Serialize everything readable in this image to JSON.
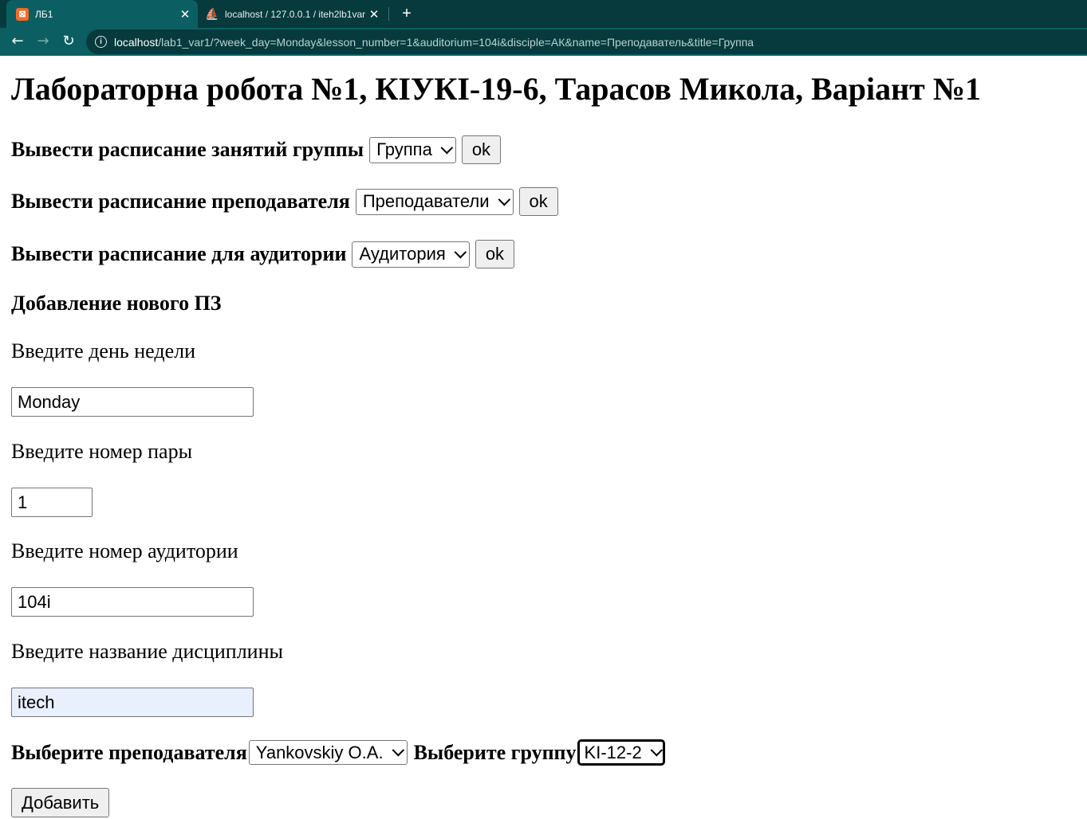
{
  "browser": {
    "tabs": [
      {
        "title": "ЛБ1",
        "favicon": "xampp-icon",
        "active": true
      },
      {
        "title": "localhost / 127.0.0.1 / iteh2lb1var",
        "favicon": "phpmyadmin-icon",
        "active": false
      }
    ],
    "url_host": "localhost",
    "url_rest": "/lab1_var1/?week_day=Monday&lesson_number=1&auditorium=104i&disciple=АК&name=Преподаватель&title=Группа",
    "colors": {
      "tabstrip": "#063a3c",
      "toolbar": "#0b5f62"
    }
  },
  "page": {
    "heading": "Лабораторна робота №1, КІУКІ-19-6, Тарасов Микола, Варіант №1",
    "group_schedule": {
      "label": "Вывести расписание занятий группы",
      "select_value": "Группа",
      "button": "ok"
    },
    "teacher_schedule": {
      "label": "Вывести расписание преподавателя",
      "select_value": "Преподаватели",
      "button": "ok"
    },
    "auditorium_schedule": {
      "label": "Вывести расписание для аудитории",
      "select_value": "Аудитория",
      "button": "ok"
    },
    "add_section": {
      "title": "Добавление нового ПЗ",
      "week_day_label": "Введите день недели",
      "week_day_value": "Monday",
      "lesson_number_label": "Введите номер пары",
      "lesson_number_value": "1",
      "auditorium_label": "Введите номер аудитории",
      "auditorium_value": "104i",
      "discipline_label": "Введите название дисциплины",
      "discipline_value": "itech",
      "teacher_label": "Выберите преподавателя",
      "teacher_value": "Yankovskiy O.A.",
      "group_label": "Выберите группу",
      "group_value": "KI-12-2",
      "submit": "Добавить"
    }
  }
}
